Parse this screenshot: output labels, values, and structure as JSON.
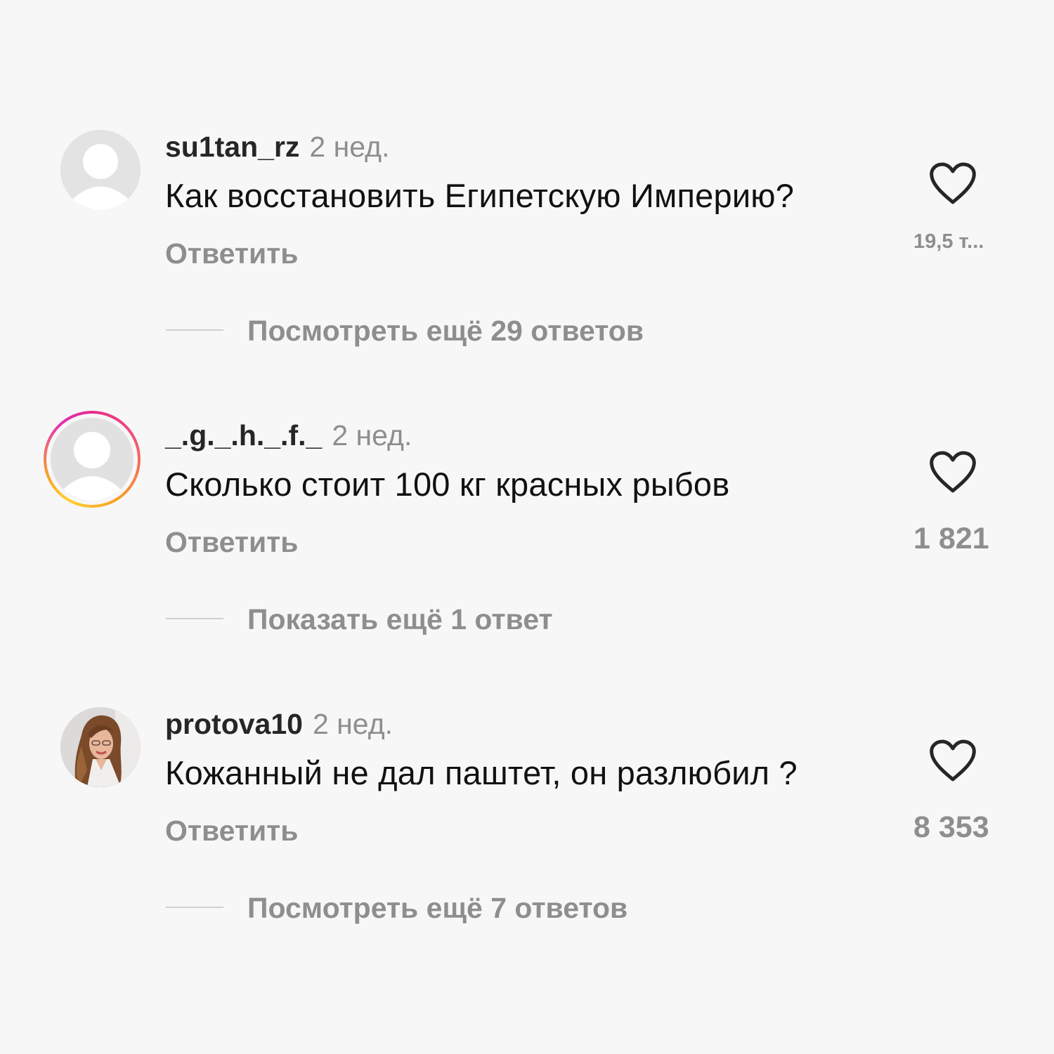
{
  "comments": [
    {
      "username": "su1tan_rz",
      "time": "2 нед.",
      "text": "Как восстановить Египетскую Империю?",
      "reply_label": "Ответить",
      "like_count": "19,5 т...",
      "replies_label": "Посмотреть ещё 29 ответов",
      "avatar": "default-avatar",
      "has_story": false
    },
    {
      "username": "_.g._.h._.f._",
      "time": "2 нед.",
      "text": "Сколько стоит 100 кг красных рыбов",
      "reply_label": "Ответить",
      "like_count": "1 821",
      "replies_label": "Показать ещё 1 ответ",
      "avatar": "default-avatar",
      "has_story": true
    },
    {
      "username": "protova10",
      "time": "2 нед.",
      "text": "Кожанный не дал паштет, он разлюбил ?",
      "reply_label": "Ответить",
      "like_count": "8 353",
      "replies_label": "Посмотреть ещё 7 ответов",
      "avatar": "photo-avatar",
      "has_story": false
    }
  ],
  "icons": {
    "like": "heart-outline-icon",
    "replies_divider": "line-divider"
  },
  "colors": {
    "background": "#f7f7f7",
    "secondary_text": "#8e8e8e",
    "primary_text": "#111111",
    "story_ring_start": "#e8298b",
    "story_ring_end": "#ffd12b"
  }
}
